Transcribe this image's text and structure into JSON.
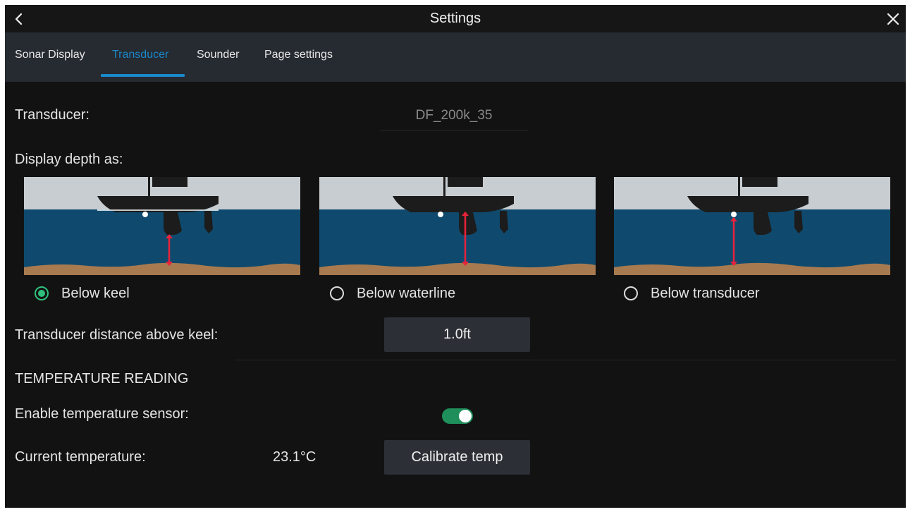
{
  "window": {
    "title": "Settings"
  },
  "tabs": [
    {
      "label": "Sonar Display",
      "active": false
    },
    {
      "label": "Transducer",
      "active": true
    },
    {
      "label": "Sounder",
      "active": false
    },
    {
      "label": "Page settings",
      "active": false
    }
  ],
  "transducer": {
    "label": "Transducer:",
    "value": "DF_200k_35"
  },
  "depth": {
    "label": "Display depth as:",
    "options": [
      {
        "label": "Below keel",
        "selected": true
      },
      {
        "label": "Below waterline",
        "selected": false
      },
      {
        "label": "Below transducer",
        "selected": false
      }
    ]
  },
  "keel_offset": {
    "label": "Transducer distance above keel:",
    "value": "1.0ft"
  },
  "temperature": {
    "section_title": "TEMPERATURE READING",
    "enable_label": "Enable temperature sensor:",
    "enabled": true,
    "current_label": "Current temperature:",
    "current_value": "23.1°C",
    "calibrate_label": "Calibrate temp"
  },
  "colors": {
    "background": "#121212",
    "tabbar": "#262a31",
    "accent_blue": "#1a88c9",
    "accent_green": "#2fc07e",
    "sky": "#c8cdd1",
    "water": "#0f4a6e",
    "seabed": "#a87a4f",
    "marker_red": "#e8223a"
  },
  "icons": {
    "back": "chevron-left-icon",
    "close": "close-icon"
  }
}
